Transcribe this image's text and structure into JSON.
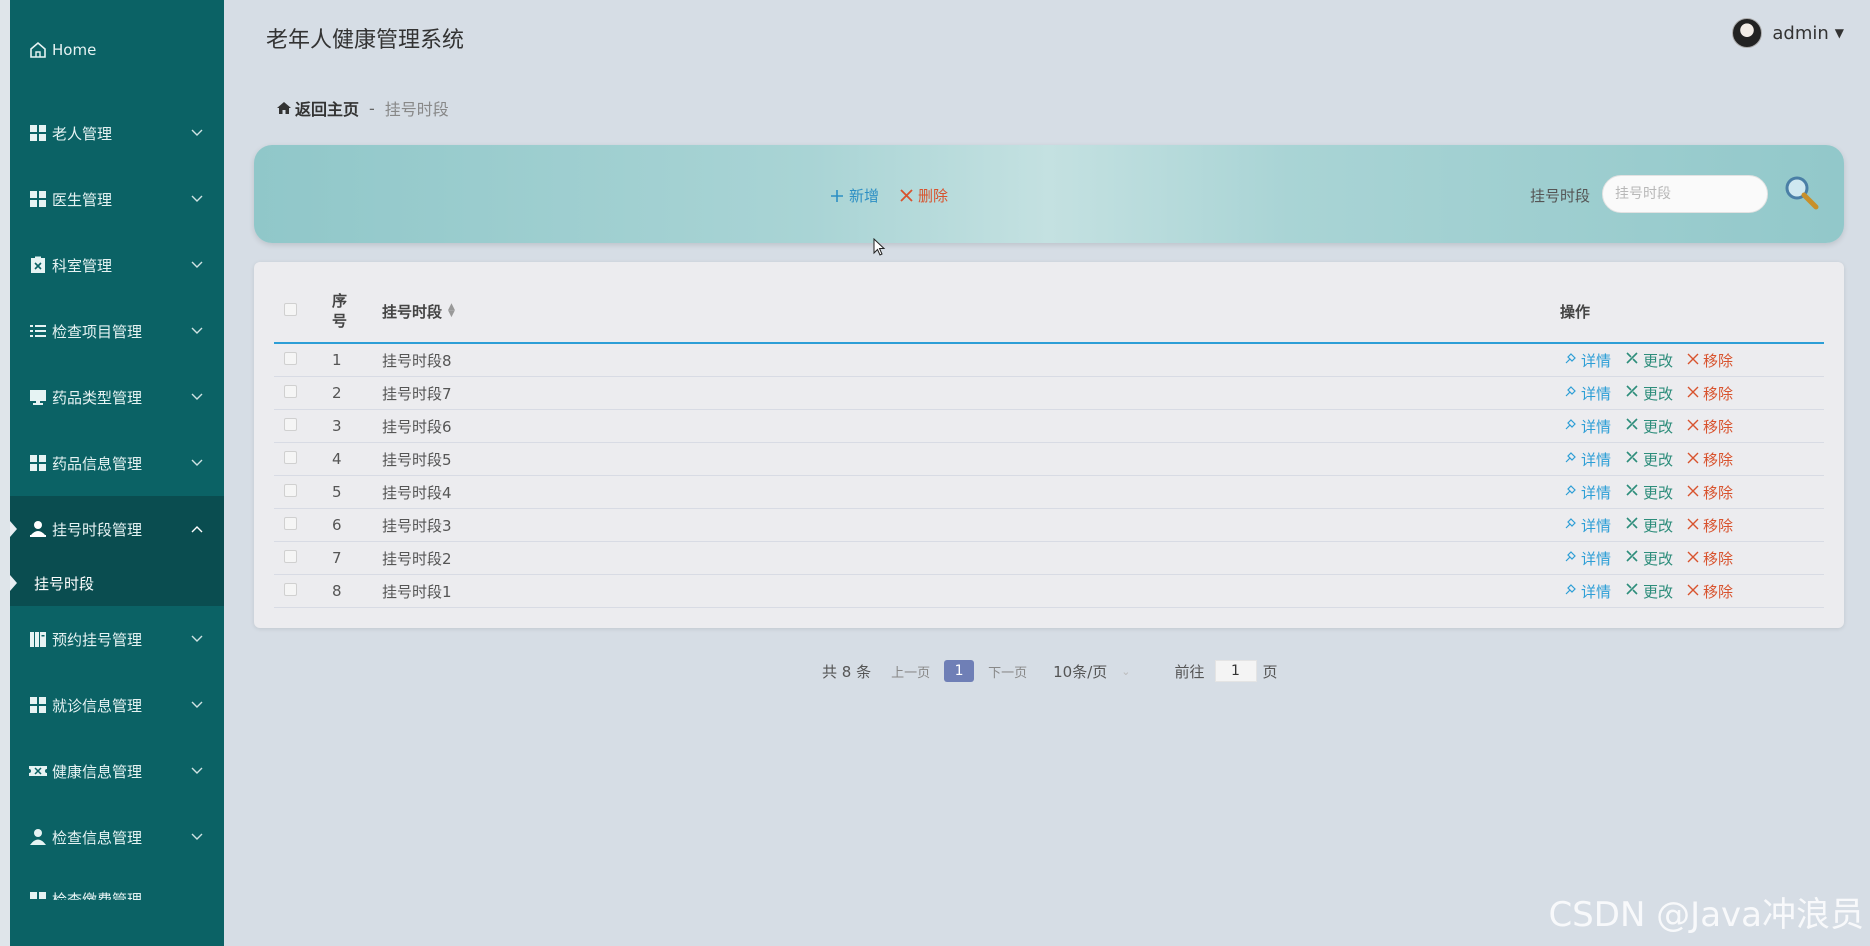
{
  "sidebar": {
    "home_label": "Home",
    "items": [
      {
        "label": "老人管理",
        "icon": "grid-icon"
      },
      {
        "label": "医生管理",
        "icon": "grid-icon"
      },
      {
        "label": "科室管理",
        "icon": "clipboard-x-icon"
      },
      {
        "label": "检查项目管理",
        "icon": "list-icon"
      },
      {
        "label": "药品类型管理",
        "icon": "monitor-icon"
      },
      {
        "label": "药品信息管理",
        "icon": "grid-icon"
      },
      {
        "label": "挂号时段管理",
        "icon": "user-badge-icon"
      },
      {
        "label": "预约挂号管理",
        "icon": "book-icon"
      },
      {
        "label": "就诊信息管理",
        "icon": "grid-icon"
      },
      {
        "label": "健康信息管理",
        "icon": "ticket-icon"
      },
      {
        "label": "检查信息管理",
        "icon": "person-icon"
      },
      {
        "label": "检查缴费管理",
        "icon": "grid-icon"
      }
    ],
    "active_sub": "挂号时段"
  },
  "header": {
    "app_title": "老年人健康管理系统",
    "username": "admin"
  },
  "breadcrumb": {
    "home": "返回主页",
    "separator": "-",
    "current": "挂号时段"
  },
  "toolbar": {
    "add_label": "新增",
    "delete_label": "删除",
    "search_label": "挂号时段",
    "search_placeholder": "挂号时段"
  },
  "table": {
    "headers": {
      "no": "序号",
      "name": "挂号时段",
      "ops": "操作"
    },
    "rows": [
      {
        "no": "1",
        "name": "挂号时段8"
      },
      {
        "no": "2",
        "name": "挂号时段7"
      },
      {
        "no": "3",
        "name": "挂号时段6"
      },
      {
        "no": "4",
        "name": "挂号时段5"
      },
      {
        "no": "5",
        "name": "挂号时段4"
      },
      {
        "no": "6",
        "name": "挂号时段3"
      },
      {
        "no": "7",
        "name": "挂号时段2"
      },
      {
        "no": "8",
        "name": "挂号时段1"
      }
    ],
    "op_detail": "详情",
    "op_edit": "更改",
    "op_remove": "移除"
  },
  "pagination": {
    "total": "共 8 条",
    "prev": "上一页",
    "current": "1",
    "next": "下一页",
    "page_size": "10条/页",
    "goto_label": "前往",
    "goto_value": "1",
    "page_suffix": "页"
  },
  "watermark": "CSDN @Java冲浪员",
  "colors": {
    "sidebar_bg": "#0b6265",
    "accent_blue": "#2d9ed6",
    "danger": "#d8532e",
    "pager_active": "#6f7fb6"
  }
}
